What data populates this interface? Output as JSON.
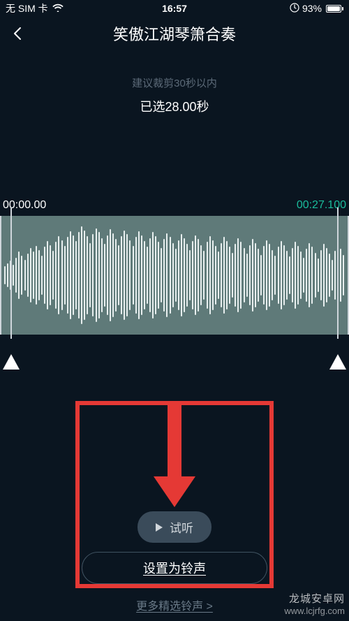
{
  "status": {
    "carrier": "无 SIM 卡",
    "time": "16:57",
    "battery_pct": "93%"
  },
  "header": {
    "title": "笑傲江湖琴箫合奏"
  },
  "editor": {
    "hint": "建议裁剪30秒以内",
    "selected_label": "已选28.00秒",
    "start_time": "00:00.00",
    "end_time": "00:27.100"
  },
  "actions": {
    "preview_label": "试听",
    "set_ringtone_label": "设置为铃声",
    "more_link_label": "更多精选铃声 >"
  },
  "watermark": {
    "line1": "龙城安卓网",
    "line2": "www.lcjrfg.com"
  },
  "colors": {
    "bg": "#0a1520",
    "accent": "#1abc9c",
    "annotation": "#e53935"
  }
}
